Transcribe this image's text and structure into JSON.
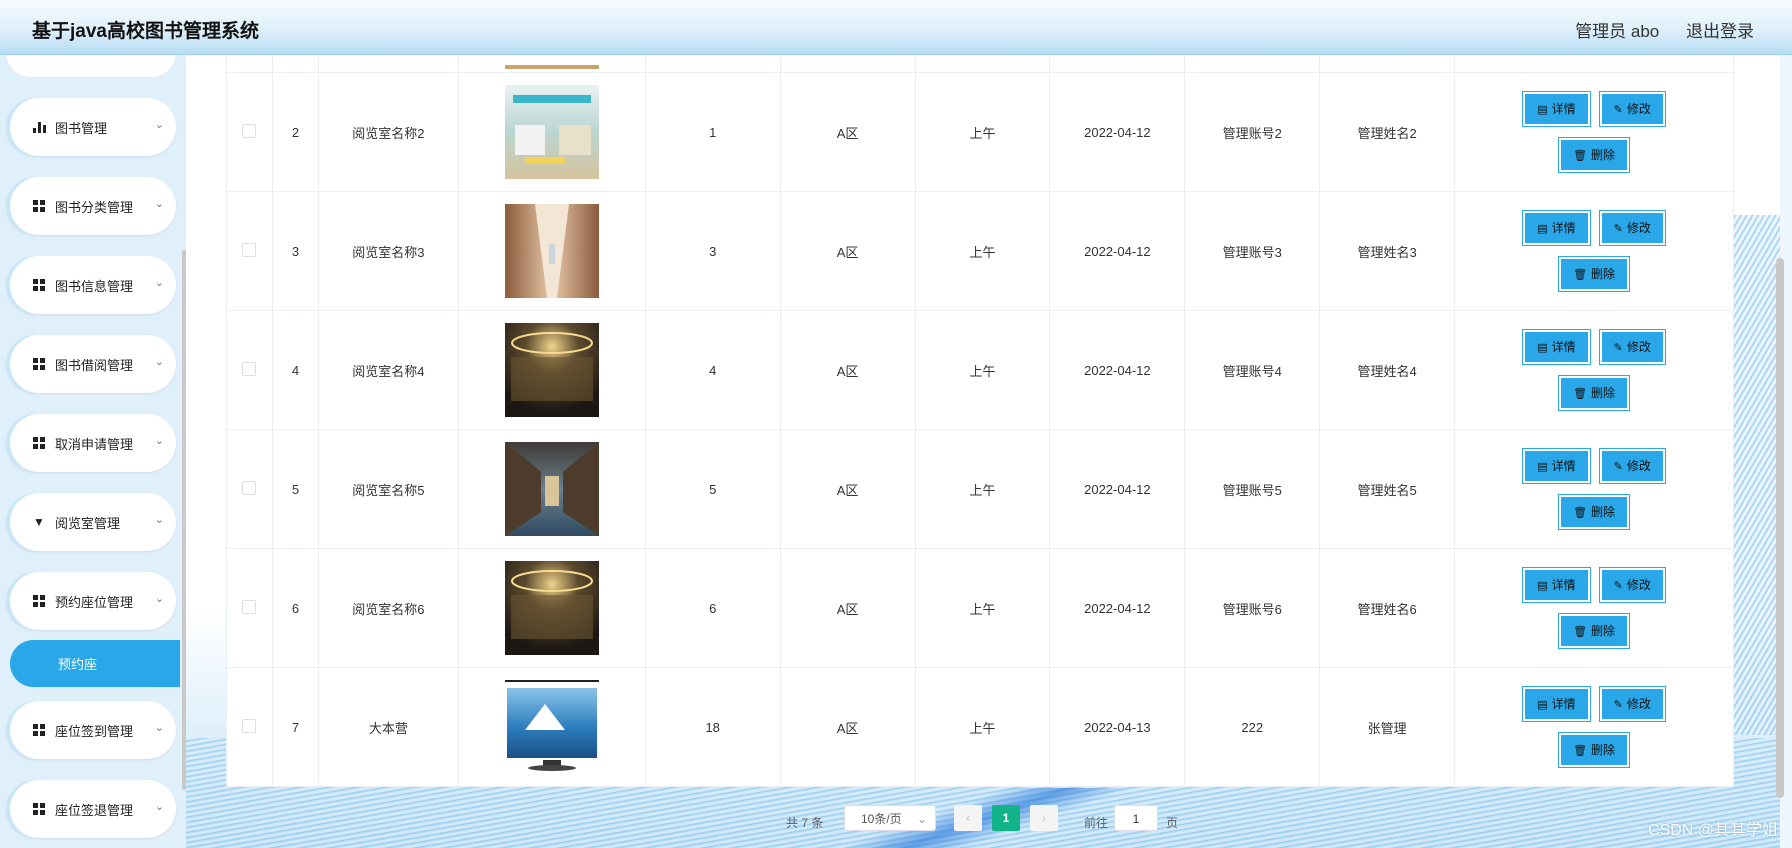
{
  "header": {
    "title": "基于java高校图书管理系统",
    "user": "管理员 abo",
    "logout": "退出登录"
  },
  "sidebar": {
    "items": [
      {
        "label": "图书管理",
        "icon": "bar-chart-icon"
      },
      {
        "label": "图书分类管理",
        "icon": "grid-icon"
      },
      {
        "label": "图书信息管理",
        "icon": "grid-icon"
      },
      {
        "label": "图书借阅管理",
        "icon": "grid-icon"
      },
      {
        "label": "取消申请管理",
        "icon": "grid-icon"
      },
      {
        "label": "阅览室管理",
        "icon": "pin-icon"
      },
      {
        "label": "预约座位管理",
        "icon": "grid-icon"
      },
      {
        "label": "座位签到管理",
        "icon": "grid-icon"
      },
      {
        "label": "座位签退管理",
        "icon": "grid-icon"
      }
    ],
    "active_sub": "预约座"
  },
  "buttons": {
    "detail": "详情",
    "edit": "修改",
    "delete": "删除"
  },
  "rows": [
    {
      "index": "2",
      "name": "阅览室名称2",
      "seat": "1",
      "area": "A区",
      "period": "上午",
      "date": "2022-04-12",
      "account": "管理账号2",
      "manager": "管理姓名2",
      "img": "bright-library"
    },
    {
      "index": "3",
      "name": "阅览室名称3",
      "seat": "3",
      "area": "A区",
      "period": "上午",
      "date": "2022-04-12",
      "account": "管理账号3",
      "manager": "管理姓名3",
      "img": "shelves-corridor"
    },
    {
      "index": "4",
      "name": "阅览室名称4",
      "seat": "4",
      "area": "A区",
      "period": "上午",
      "date": "2022-04-12",
      "account": "管理账号4",
      "manager": "管理姓名4",
      "img": "dark-rotunda"
    },
    {
      "index": "5",
      "name": "阅览室名称5",
      "seat": "5",
      "area": "A区",
      "period": "上午",
      "date": "2022-04-12",
      "account": "管理账号5",
      "manager": "管理姓名5",
      "img": "long-hall"
    },
    {
      "index": "6",
      "name": "阅览室名称6",
      "seat": "6",
      "area": "A区",
      "period": "上午",
      "date": "2022-04-12",
      "account": "管理账号6",
      "manager": "管理姓名6",
      "img": "dark-rotunda"
    },
    {
      "index": "7",
      "name": "大本营",
      "seat": "18",
      "area": "A区",
      "period": "上午",
      "date": "2022-04-13",
      "account": "222",
      "manager": "张管理",
      "img": "tv-mountain"
    }
  ],
  "pager": {
    "total": "共 7 条",
    "size": "10条/页",
    "current": "1",
    "goto": "前往",
    "page_input": "1",
    "page_suffix": "页"
  },
  "watermark": "CSDN @其其学姐",
  "colors": {
    "primary": "#29a7e8",
    "pager_active": "#13b38a"
  }
}
